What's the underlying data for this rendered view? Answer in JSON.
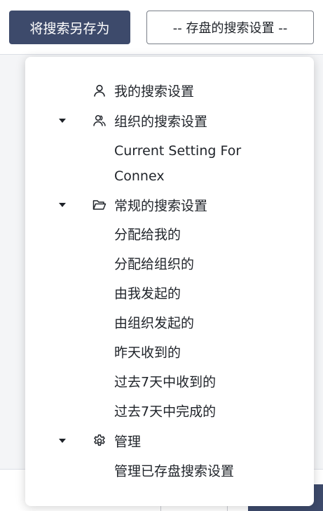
{
  "toolbar": {
    "save_as_label": "将搜索另存为",
    "saved_searches_select": "-- 存盘的搜索设置 --"
  },
  "menu": {
    "my_searches": {
      "label": "我的搜索设置",
      "icon": "user-icon"
    },
    "org_searches": {
      "label": "组织的搜索设置",
      "icon": "users-icon",
      "items": [
        "Current Setting For",
        "Connex"
      ]
    },
    "general_searches": {
      "label": "常规的搜索设置",
      "icon": "folder-open-icon",
      "items": [
        "分配给我的",
        "分配给组织的",
        "由我发起的",
        "由组织发起的",
        "昨天收到的",
        "过去7天中收到的",
        "过去7天中完成的"
      ]
    },
    "manage": {
      "label": "管理",
      "icon": "gear-icon",
      "items": [
        "管理已存盘搜索设置"
      ]
    }
  }
}
